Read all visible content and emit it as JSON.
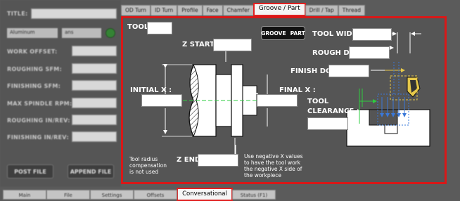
{
  "left_panel": {
    "title_label": "TITLE:",
    "material_select": "Aluminum",
    "units_select": "ans",
    "labels": [
      "WORK OFFSET:",
      "ROUGHING SFM:",
      "FINISHING SFM:",
      "MAX SPINDLE RPM:",
      "ROUGHING IN/REV:",
      "FINISHING IN/REV:"
    ],
    "post_button": "POST FILE",
    "append_button": "APPEND FILE"
  },
  "tabs": [
    "OD Turn",
    "ID Turn",
    "Profile",
    "Face",
    "Chamfer",
    "Groove / Part",
    "Drill / Tap",
    "Thread"
  ],
  "active_tab": "Groove / Part",
  "groove": {
    "tool_label": "TOOL :",
    "z_start_label": "Z START :",
    "initial_x_label": "INITIAL X :",
    "final_x_label": "FINAL X :",
    "z_end_label": "Z END :",
    "tool_width_label": "TOOL WIDTH :",
    "rough_doc_label": "ROUGH DOC :",
    "finish_doc_label": "FINISH DOC :",
    "tool_clearance_label_1": "TOOL",
    "tool_clearance_label_2": "CLEARANCE :",
    "toggle_left": "GROOVE",
    "toggle_right": "PART",
    "plus": "+",
    "minus": "–",
    "note_radius": [
      "Tool radius",
      "compensation",
      "is not used"
    ],
    "note_negative_x": [
      "Use negative X values",
      "to have the tool work",
      "the negative X side of",
      "the workpiece"
    ]
  },
  "bottom_tabs": [
    "Main",
    "File",
    "Settings",
    "Offsets",
    "Conversational",
    "Status (F1)"
  ],
  "active_bottom_tab": "Conversational",
  "colors": {
    "highlight": "#e02020",
    "led": "#2e8b2e",
    "diagram_blue": "#3a78d8",
    "diagram_yellow": "#e6c84a",
    "centerline_green": "#2ecc40"
  }
}
